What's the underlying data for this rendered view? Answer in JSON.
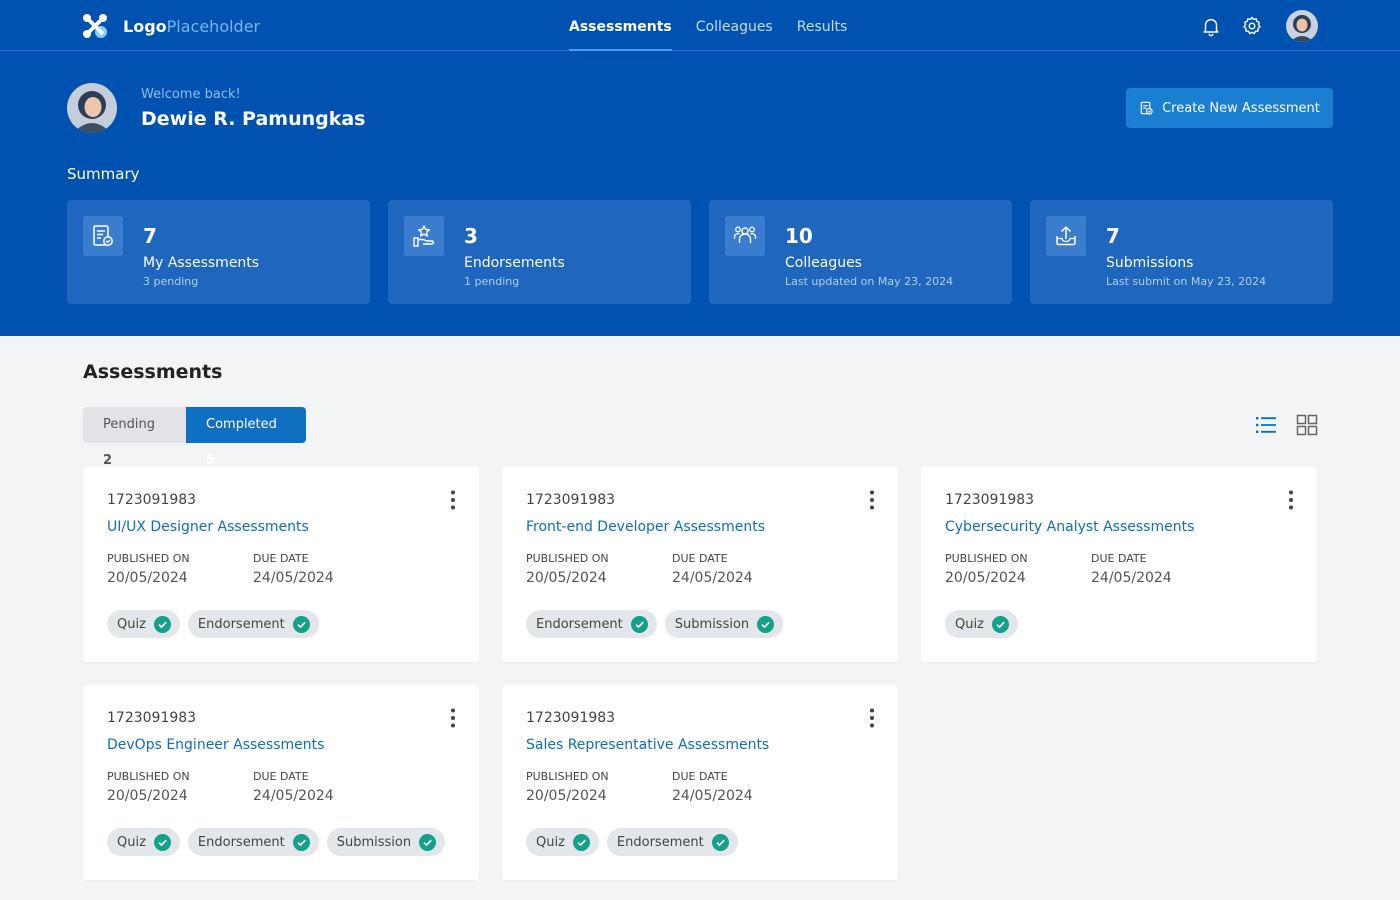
{
  "brand": {
    "bold": "Logo",
    "light": "Placeholder"
  },
  "nav": {
    "items": [
      {
        "label": "Assessments",
        "active": true
      },
      {
        "label": "Colleagues",
        "active": false
      },
      {
        "label": "Results",
        "active": false
      }
    ]
  },
  "header_icons": [
    "bell-icon",
    "gear-icon"
  ],
  "colors": {
    "primary": "#0052b0",
    "accent": "#0f6fc0",
    "check": "#12a18a",
    "link": "#0e6fbd"
  },
  "user": {
    "welcome": "Welcome back!",
    "name": "Dewie R. Pamungkas"
  },
  "create_button": "Create New Assessment",
  "summary": {
    "title": "Summary",
    "cards": [
      {
        "count": "7",
        "label": "My Assessments",
        "sub": "3 pending",
        "icon": "assessment-icon"
      },
      {
        "count": "3",
        "label": "Endorsements",
        "sub": "1 pending",
        "icon": "endorsement-icon"
      },
      {
        "count": "10",
        "label": "Colleagues",
        "sub": "Last updated on May 23, 2024",
        "icon": "colleagues-icon"
      },
      {
        "count": "7",
        "label": "Submissions",
        "sub": "Last submit on May 23, 2024",
        "icon": "upload-icon"
      }
    ]
  },
  "assessments": {
    "title": "Assessments",
    "tabs": [
      {
        "label": "Pending",
        "count": "2"
      },
      {
        "label": "Completed",
        "count": "5"
      }
    ],
    "published_label": "PUBLISHED ON",
    "due_label": "DUE DATE",
    "cards": [
      {
        "id": "1723091983",
        "title": "UI/UX Designer Assessments",
        "published": "20/05/2024",
        "due": "24/05/2024",
        "tags": [
          "Quiz",
          "Endorsement"
        ]
      },
      {
        "id": "1723091983",
        "title": "Front-end Developer Assessments",
        "published": "20/05/2024",
        "due": "24/05/2024",
        "tags": [
          "Endorsement",
          "Submission"
        ]
      },
      {
        "id": "1723091983",
        "title": "Cybersecurity Analyst Assessments",
        "published": "20/05/2024",
        "due": "24/05/2024",
        "tags": [
          "Quiz"
        ]
      },
      {
        "id": "1723091983",
        "title": "DevOps Engineer Assessments",
        "published": "20/05/2024",
        "due": "24/05/2024",
        "tags": [
          "Quiz",
          "Endorsement",
          "Submission"
        ]
      },
      {
        "id": "1723091983",
        "title": "Sales Representative Assessments",
        "published": "20/05/2024",
        "due": "24/05/2024",
        "tags": [
          "Quiz",
          "Endorsement"
        ]
      }
    ]
  }
}
